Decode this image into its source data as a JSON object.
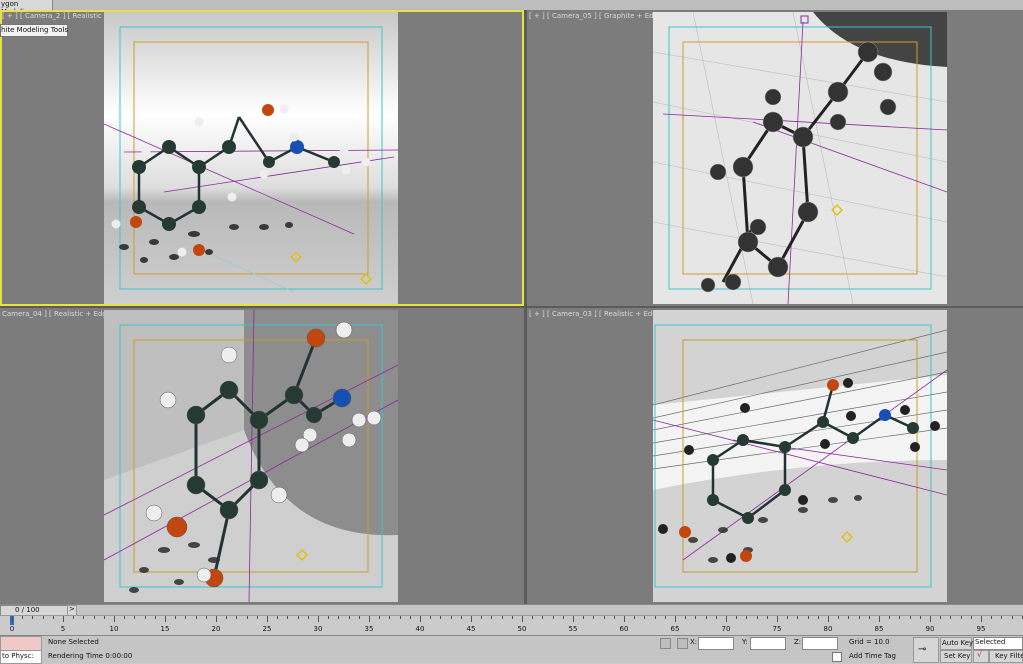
{
  "ribbon": {
    "tab_label": "ygon Modeling",
    "tooltip_label": "hite Modeling Tools"
  },
  "viewports": [
    {
      "label": "[ + ] [ Camera_2 ] [ Realistic ]"
    },
    {
      "label": "[ + ] [ Camera_05 ] [ Graphite + Edged Fa"
    },
    {
      "label": "Camera_04 ] [ Realistic + Edged Fa"
    },
    {
      "label": "[ + ] [ Camera_03 ] [ Realistic + Edged Fa"
    }
  ],
  "timeline": {
    "frame_counter": "0 / 100",
    "ticks": [
      "0",
      "5",
      "10",
      "15",
      "20",
      "25",
      "30",
      "35",
      "40",
      "45",
      "50",
      "55",
      "60",
      "65",
      "70",
      "75",
      "80",
      "85",
      "90",
      "95"
    ]
  },
  "status": {
    "script_label": "to Physc:",
    "selection": "None Selected",
    "rendering": "Rendering Time  0:00:00",
    "x_label": "X:",
    "y_label": "Y:",
    "z_label": "Z:",
    "grid": "Grid = 10.0",
    "add_time_tag": "Add Time Tag",
    "auto_key": "Auto Key",
    "set_key": "Set Key",
    "selected_dropdown": "Selected",
    "key_filters": "Key Filte"
  },
  "colors": {
    "active_border": "#e8e23a",
    "safe_frame_cyan": "#39c6cf",
    "safe_frame_orange": "#d09a2a",
    "hydroxyl_orange": "#c2470f",
    "nitrogen_blue": "#1750b4",
    "carbon_dark": "#243a33"
  }
}
